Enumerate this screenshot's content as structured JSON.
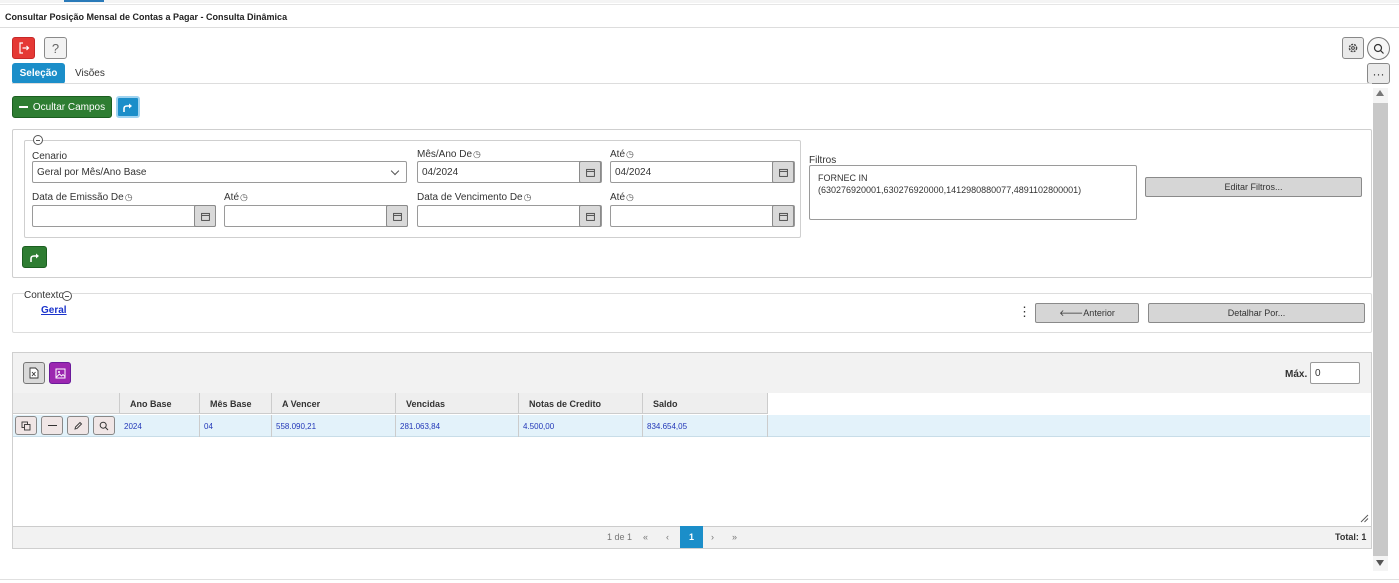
{
  "window": {
    "title": "Consultar Posição Mensal de Contas a Pagar - Consulta Dinâmica"
  },
  "toolbar": {
    "help_label": "?",
    "more_label": "···"
  },
  "tabs": [
    {
      "label": "Seleção",
      "active": true
    },
    {
      "label": "Visões",
      "active": false
    }
  ],
  "actions": {
    "ocultar_campos_label": "Ocultar Campos"
  },
  "form": {
    "cenario": {
      "label": "Cenario",
      "value": "Geral por Mês/Ano Base"
    },
    "mes_ano_de": {
      "label": "Mês/Ano De",
      "value": "04/2024"
    },
    "mes_ano_ate": {
      "label": "Até",
      "value": "04/2024"
    },
    "data_emissao_de": {
      "label": "Data de Emissão De",
      "value": ""
    },
    "data_emissao_ate": {
      "label": "Até",
      "value": ""
    },
    "data_vencimento_de": {
      "label": "Data de Vencimento De",
      "value": ""
    },
    "data_vencimento_ate": {
      "label": "Até",
      "value": ""
    },
    "filtros": {
      "label": "Filtros",
      "line1": "FORNEC IN",
      "line2": "(630276920001,630276920000,1412980880077,4891102800001)",
      "edit_label": "Editar Filtros..."
    }
  },
  "context": {
    "label": "Contexto",
    "link": "Geral",
    "anterior_label": "🡐Anterior",
    "detalhar_label": "Detalhar Por..."
  },
  "grid": {
    "max_label": "Máx.",
    "max_value": "0",
    "columns": [
      "Ano Base",
      "Mês Base",
      "A Vencer",
      "Vencidas",
      "Notas de Credito",
      "Saldo"
    ],
    "rows": [
      [
        "2024",
        "04",
        "558.090,21",
        "281.063,84",
        "4.500,00",
        "834.654,05"
      ]
    ],
    "pager": {
      "page_text": "1 de 1",
      "first": "«",
      "prev": "‹",
      "current": "1",
      "next": "›",
      "last": "»",
      "total_label": "Total: 1"
    }
  },
  "colors": {
    "primary_blue": "#1b8ec9",
    "green": "#2e7d32",
    "red": "#e53935",
    "purple": "#9c27b0",
    "link_blue": "#1a33cc"
  }
}
